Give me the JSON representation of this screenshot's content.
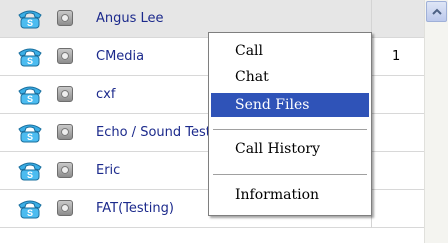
{
  "contacts": [
    {
      "name": "Angus Lee",
      "count": "",
      "selected": true
    },
    {
      "name": "CMedia",
      "count": "1",
      "selected": false
    },
    {
      "name": "cxf",
      "count": "",
      "selected": false
    },
    {
      "name": "Echo / Sound Test Service",
      "count": "",
      "selected": false
    },
    {
      "name": "Eric",
      "count": "",
      "selected": false
    },
    {
      "name": "FAT(Testing)",
      "count": "",
      "selected": false
    }
  ],
  "context_menu": {
    "call": "Call",
    "chat": "Chat",
    "send_files": "Send Files",
    "call_history": "Call History",
    "information": "Information",
    "highlighted": "Send Files"
  },
  "icons": {
    "contact_status": "skype-phone-icon",
    "secondary_status": "offline-status-icon",
    "scroll": "chevron-up-icon"
  },
  "colors": {
    "phone_icon": "#3aaee6",
    "name_text": "#1c2a8c",
    "menu_highlight": "#2f53b8",
    "selected_row": "#e6e6e6"
  }
}
